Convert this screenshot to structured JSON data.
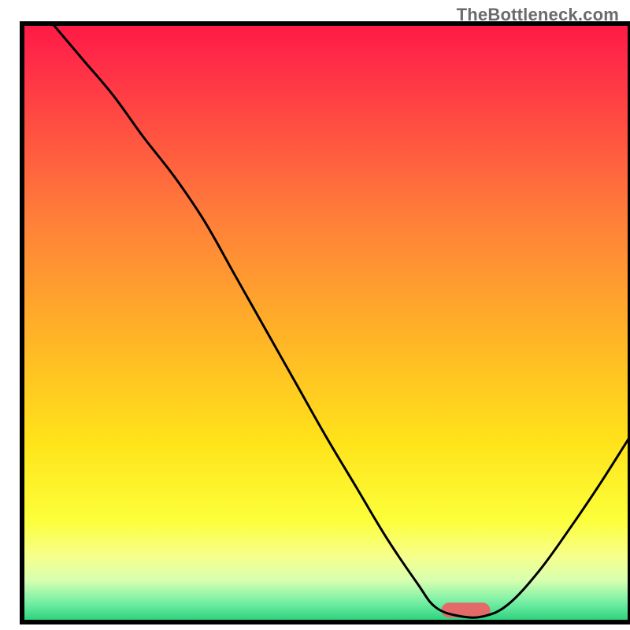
{
  "watermark": "TheBottleneck.com",
  "chart_data": {
    "type": "line",
    "title": "",
    "xlabel": "",
    "ylabel": "",
    "xlim": [
      0,
      100
    ],
    "ylim": [
      0,
      100
    ],
    "grid": false,
    "legend": false,
    "background_gradient": {
      "direction": "vertical",
      "stops": [
        {
          "offset": 0.0,
          "color": "#ff1a44"
        },
        {
          "offset": 0.05,
          "color": "#ff2848"
        },
        {
          "offset": 0.32,
          "color": "#ff7d3a"
        },
        {
          "offset": 0.52,
          "color": "#ffb327"
        },
        {
          "offset": 0.7,
          "color": "#ffe31a"
        },
        {
          "offset": 0.83,
          "color": "#fcff3a"
        },
        {
          "offset": 0.89,
          "color": "#f6ff8c"
        },
        {
          "offset": 0.93,
          "color": "#d8ffb0"
        },
        {
          "offset": 0.965,
          "color": "#7af0a6"
        },
        {
          "offset": 1.0,
          "color": "#23d07a"
        }
      ]
    },
    "marker": {
      "x": 73,
      "y": 2,
      "width": 8,
      "height": 2.5,
      "color": "#e46a6a",
      "rx": 3
    },
    "series": [
      {
        "name": "curve",
        "color": "#000000",
        "stroke_width": 3,
        "x": [
          5,
          10,
          15,
          20,
          25,
          30,
          35,
          40,
          45,
          50,
          55,
          60,
          65,
          68,
          72,
          76,
          80,
          85,
          90,
          95,
          100
        ],
        "y": [
          100,
          94,
          88,
          81,
          74.5,
          67,
          58,
          49,
          40,
          31,
          22.5,
          14,
          6.5,
          2.5,
          1.0,
          1.0,
          3.0,
          8.5,
          15.5,
          23,
          31
        ]
      }
    ]
  }
}
